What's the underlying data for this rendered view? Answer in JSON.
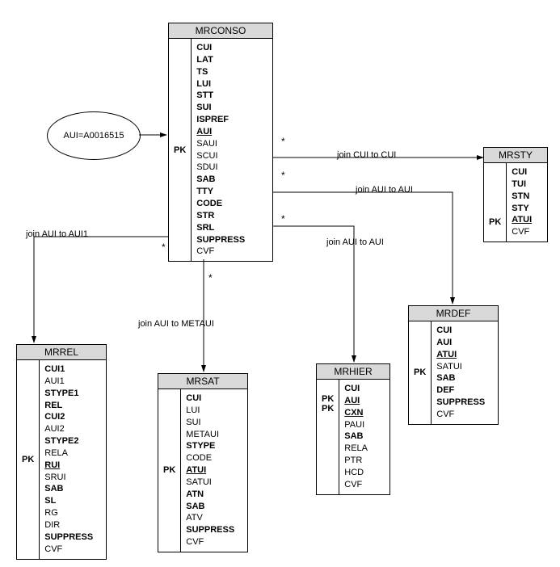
{
  "start_node": {
    "label": "AUI=A0016515"
  },
  "entities": {
    "mrconso": {
      "name": "MRCONSO",
      "pk": [
        "PK"
      ],
      "cols": [
        {
          "t": "CUI",
          "b": true
        },
        {
          "t": "LAT",
          "b": true
        },
        {
          "t": "TS",
          "b": true
        },
        {
          "t": "LUI",
          "b": true
        },
        {
          "t": "STT",
          "b": true
        },
        {
          "t": "SUI",
          "b": true
        },
        {
          "t": "ISPREF",
          "b": true
        },
        {
          "t": "AUI",
          "b": true,
          "u": true
        },
        {
          "t": "SAUI"
        },
        {
          "t": "SCUI"
        },
        {
          "t": "SDUI"
        },
        {
          "t": "SAB",
          "b": true
        },
        {
          "t": "TTY",
          "b": true
        },
        {
          "t": "CODE",
          "b": true
        },
        {
          "t": "STR",
          "b": true
        },
        {
          "t": "SRL",
          "b": true
        },
        {
          "t": "SUPPRESS",
          "b": true
        },
        {
          "t": "CVF"
        }
      ]
    },
    "mrsty": {
      "name": "MRSTY",
      "pk": [
        "PK"
      ],
      "cols": [
        {
          "t": "CUI",
          "b": true
        },
        {
          "t": "TUI",
          "b": true
        },
        {
          "t": "STN",
          "b": true
        },
        {
          "t": "STY",
          "b": true
        },
        {
          "t": "ATUI",
          "b": true,
          "u": true
        },
        {
          "t": "CVF"
        }
      ]
    },
    "mrrel": {
      "name": "MRREL",
      "pk": [
        "PK"
      ],
      "cols": [
        {
          "t": "CUI1",
          "b": true
        },
        {
          "t": "AUI1"
        },
        {
          "t": "STYPE1",
          "b": true
        },
        {
          "t": "REL",
          "b": true
        },
        {
          "t": "CUI2",
          "b": true
        },
        {
          "t": "AUI2"
        },
        {
          "t": "STYPE2",
          "b": true
        },
        {
          "t": "RELA"
        },
        {
          "t": "RUI",
          "b": true,
          "u": true
        },
        {
          "t": "SRUI"
        },
        {
          "t": "SAB",
          "b": true
        },
        {
          "t": "SL",
          "b": true
        },
        {
          "t": "RG"
        },
        {
          "t": "DIR"
        },
        {
          "t": "SUPPRESS",
          "b": true
        },
        {
          "t": "CVF"
        }
      ]
    },
    "mrsat": {
      "name": "MRSAT",
      "pk": [
        "PK"
      ],
      "cols": [
        {
          "t": "CUI",
          "b": true
        },
        {
          "t": "LUI"
        },
        {
          "t": "SUI"
        },
        {
          "t": "METAUI"
        },
        {
          "t": "STYPE",
          "b": true
        },
        {
          "t": "CODE"
        },
        {
          "t": "ATUI",
          "b": true,
          "u": true
        },
        {
          "t": "SATUI"
        },
        {
          "t": "ATN",
          "b": true
        },
        {
          "t": "SAB",
          "b": true
        },
        {
          "t": "ATV"
        },
        {
          "t": "SUPPRESS",
          "b": true
        },
        {
          "t": "CVF"
        }
      ]
    },
    "mrhier": {
      "name": "MRHIER",
      "pk": [
        "PK",
        "PK"
      ],
      "cols": [
        {
          "t": "CUI",
          "b": true
        },
        {
          "t": "AUI",
          "b": true,
          "u": true
        },
        {
          "t": "CXN",
          "b": true,
          "u": true
        },
        {
          "t": "PAUI"
        },
        {
          "t": "SAB",
          "b": true
        },
        {
          "t": "RELA"
        },
        {
          "t": "PTR"
        },
        {
          "t": "HCD"
        },
        {
          "t": "CVF"
        }
      ]
    },
    "mrdef": {
      "name": "MRDEF",
      "pk": [
        "PK"
      ],
      "cols": [
        {
          "t": "CUI",
          "b": true
        },
        {
          "t": "AUI",
          "b": true
        },
        {
          "t": "ATUI",
          "b": true,
          "u": true
        },
        {
          "t": "SATUI"
        },
        {
          "t": "SAB",
          "b": true
        },
        {
          "t": "DEF",
          "b": true
        },
        {
          "t": "SUPPRESS",
          "b": true
        },
        {
          "t": "CVF"
        }
      ]
    }
  },
  "edges": {
    "start_to_mrconso": "",
    "to_mrsty": "join CUI to CUI",
    "to_mrdef": "join AUI to AUI",
    "to_mrhier": "join AUI to AUI",
    "to_mrrel": "join AUI to AUI1",
    "to_mrsat": "join AUI to METAUI"
  },
  "stars": {
    "s1": "*",
    "s2": "*",
    "s3": "*",
    "s4": "*",
    "s5": "*"
  }
}
